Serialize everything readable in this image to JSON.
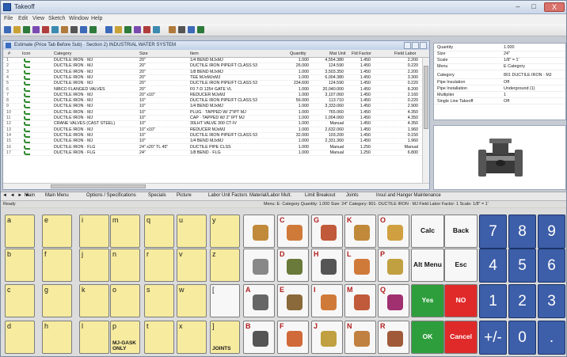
{
  "window": {
    "title": "Takeoff",
    "minimize": "–",
    "maximize": "□",
    "close": "X"
  },
  "menu": [
    "File",
    "Edit",
    "View",
    "Sketch",
    "Window",
    "Help"
  ],
  "toolbar_icons": [
    "new-icon",
    "open-icon",
    "save-icon",
    "print-icon",
    "cut-icon",
    "copy-icon",
    "paste-icon",
    "undo-icon",
    "find-icon",
    "grid-icon",
    "sketch-icon",
    "zoom-icon",
    "pipe-icon",
    "fitting-icon",
    "valve-icon",
    "settings-icon",
    "report-icon",
    "chart-icon",
    "calc-icon",
    "help-icon"
  ],
  "estimate": {
    "title": "Estimate (Price Tab Before Sub) · Section 2) INDUSTRIAL WATER SYSTEM",
    "columns": {
      "num": "#",
      "icon": "Icon",
      "category": "Category",
      "size": "Size",
      "item": "Item",
      "quantity": "Quantity",
      "mat": "Mat Unit",
      "fld": "Fld Factor",
      "labor": "Field Labor"
    },
    "rows": [
      {
        "n": "1",
        "cat": "DUCTILE IRON · MJ",
        "size": "20\"",
        "item": "1/4 BEND MJxMJ",
        "qty": "1.000",
        "mat": "4,554.380",
        "fld": "1.450",
        "lab": "2.200"
      },
      {
        "n": "2",
        "cat": "DUCTILE IRON · MJ",
        "size": "20\"",
        "item": "DUCTILE IRON PIPE/FT CLASS 53",
        "qty": "26.000",
        "mat": "124.590",
        "fld": "1.450",
        "lab": "0.220"
      },
      {
        "n": "3",
        "cat": "DUCTILE IRON · MJ",
        "size": "20\"",
        "item": "1/8 BEND MJxMJ",
        "qty": "1.000",
        "mat": "3,503.350",
        "fld": "1.450",
        "lab": "2.200"
      },
      {
        "n": "4",
        "cat": "DUCTILE IRON · MJ",
        "size": "20\"",
        "item": "TEE MJxMJxMJ",
        "qty": "1.000",
        "mat": "6,004.380",
        "fld": "1.450",
        "lab": "3.300"
      },
      {
        "n": "5",
        "cat": "DUCTILE IRON · MJ",
        "size": "20\"",
        "item": "DUCTILE IRON PIPE/FT CLASS 53",
        "qty": "234.600",
        "mat": "124.590",
        "fld": "1.450",
        "lab": "0.220"
      },
      {
        "n": "6",
        "cat": "NIBCO FLANGED VALVES",
        "size": "20\"",
        "item": "F0 7-D 125# GATE VL",
        "qty": "1.000",
        "mat": "20,040.000",
        "fld": "1.450",
        "lab": "8.200"
      },
      {
        "n": "7",
        "cat": "DUCTILE IRON · MJ",
        "size": "20\" x10\"",
        "item": "REDUCER MJxMJ",
        "qty": "1.000",
        "mat": "3,107.060",
        "fld": "1.450",
        "lab": "2.160"
      },
      {
        "n": "8",
        "cat": "DUCTILE IRON · MJ",
        "size": "10\"",
        "item": "DUCTILE IRON PIPE/FT CLASS 53",
        "qty": "56.000",
        "mat": "113.710",
        "fld": "1.450",
        "lab": "0.220"
      },
      {
        "n": "9",
        "cat": "DUCTILE IRON · MJ",
        "size": "10\"",
        "item": "1/4 BEND MJxMJ",
        "qty": "1.000",
        "mat": "3,333.060",
        "fld": "1.450",
        "lab": "2.900"
      },
      {
        "n": "10",
        "cat": "DUCTILE IRON · MJ",
        "size": "10\"",
        "item": "PLUG · TAPPED W/ 2\"IPT MJ",
        "qty": "1.000",
        "mat": "765.060",
        "fld": "1.450",
        "lab": "4.350"
      },
      {
        "n": "11",
        "cat": "DUCTILE IRON · MJ",
        "size": "10\"",
        "item": "CAP · TAPPED W/ 2\" IPT MJ",
        "qty": "1.000",
        "mat": "1,004.060",
        "fld": "1.450",
        "lab": "4.350"
      },
      {
        "n": "12",
        "cat": "CRANE VALVES (CAST STEEL)",
        "size": "10\"",
        "item": "30LHT VALVE 300 CT-IV",
        "qty": "1.000",
        "mat": "Manual",
        "fld": "1.450",
        "lab": "4.350"
      },
      {
        "n": "13",
        "cat": "DUCTILE IRON · MJ",
        "size": "10\" x10\"",
        "item": "REDUCER MJxMJ",
        "qty": "1.000",
        "mat": "2,632.060",
        "fld": "1.450",
        "lab": "1.960"
      },
      {
        "n": "14",
        "cat": "DUCTILE IRON · MJ",
        "size": "10\"",
        "item": "DUCTILE IRON PIPE/FT CLASS 53",
        "qty": "32.000",
        "mat": "103.200",
        "fld": "1.450",
        "lab": "0.150"
      },
      {
        "n": "15",
        "cat": "DUCTILE IRON · MJ",
        "size": "10\"",
        "item": "1/4 BEND MJxMJ",
        "qty": "1.000",
        "mat": "2,331.360",
        "fld": "1.450",
        "lab": "1.960"
      },
      {
        "n": "16",
        "cat": "DUCTILE IRON · FLG",
        "size": "24\" x20\" TL 45\"",
        "item": "DUCTILE PIPE CLSS",
        "qty": "1.000",
        "mat": "Manual",
        "fld": "1.250",
        "lab": "Manual"
      },
      {
        "n": "17",
        "cat": "DUCTILE IRON · FLG",
        "size": "24\"",
        "item": "1/8 BEND · FLG",
        "qty": "1.000",
        "mat": "Manual",
        "fld": "1.250",
        "lab": "6.800"
      }
    ]
  },
  "properties": [
    {
      "label": "Quantity",
      "value": "1.000"
    },
    {
      "label": "Size",
      "value": "24\""
    },
    {
      "label": "Scale",
      "value": "1/8\" = 1'"
    },
    {
      "label": "Menu",
      "value": "E Category"
    },
    {
      "label": "Category",
      "value": "801 DUCTILE IRON · MJ"
    },
    {
      "label": "Pipe Insulation",
      "value": "Off"
    },
    {
      "label": "Pipe Installation",
      "value": "Underground (1)"
    },
    {
      "label": "Multiplier",
      "value": "1"
    },
    {
      "label": "Single Line Takeoff",
      "value": "Off"
    }
  ],
  "sheet_tabs": {
    "nav": "◄ ◄ ► ►",
    "tabs": [
      "Main",
      "Main Menu",
      "Options / Specifications",
      "Specials",
      "Picture",
      "Labor Unit Factors",
      "Material/Labor Mult.",
      "Limit Breakout",
      "Joints",
      "Insul and Hanger Maintenance"
    ]
  },
  "status": {
    "ready": "Ready",
    "info": "Menu: E· Category   Quantity: 1.000   Size: 24\"   Category: 801· DUCTILE IRON · MJ   Field Labor Factor: 1   Scale: 1/8\" = 1'"
  },
  "keypad": {
    "letter_keys": [
      {
        "l": "a",
        "cap": "",
        "color": "yellow"
      },
      {
        "l": "e",
        "cap": "",
        "color": "yellow"
      },
      {
        "l": "i",
        "cap": "",
        "color": "yellow"
      },
      {
        "l": "m",
        "cap": "",
        "color": "yellow"
      },
      {
        "l": "q",
        "cap": "",
        "color": "yellow"
      },
      {
        "l": "u",
        "cap": "",
        "color": "yellow"
      },
      {
        "l": "y",
        "cap": "",
        "color": "yellow"
      },
      {
        "l": "b",
        "cap": "",
        "color": "yellow"
      },
      {
        "l": "f",
        "cap": "",
        "color": "yellow"
      },
      {
        "l": "j",
        "cap": "",
        "color": "yellow"
      },
      {
        "l": "n",
        "cap": "",
        "color": "yellow"
      },
      {
        "l": "r",
        "cap": "",
        "color": "yellow"
      },
      {
        "l": "v",
        "cap": "",
        "color": "yellow"
      },
      {
        "l": "z",
        "cap": "",
        "color": "yellow"
      },
      {
        "l": "c",
        "cap": "",
        "color": "yellow"
      },
      {
        "l": "g",
        "cap": "",
        "color": "yellow"
      },
      {
        "l": "k",
        "cap": "",
        "color": "yellow"
      },
      {
        "l": "o",
        "cap": "",
        "color": "yellow"
      },
      {
        "l": "s",
        "cap": "",
        "color": "yellow"
      },
      {
        "l": "w",
        "cap": "",
        "color": "yellow"
      },
      {
        "l": "[",
        "cap": "",
        "color": "white"
      },
      {
        "l": "d",
        "cap": "",
        "color": "yellow"
      },
      {
        "l": "h",
        "cap": "",
        "color": "yellow"
      },
      {
        "l": "l",
        "cap": "",
        "color": "yellow"
      },
      {
        "l": "p",
        "cap": "MJ-GASK ONLY",
        "color": "yellow"
      },
      {
        "l": "t",
        "cap": "",
        "color": "yellow"
      },
      {
        "l": "x",
        "cap": "",
        "color": "yellow"
      },
      {
        "l": "]",
        "cap": "JOINTS",
        "color": "yellow"
      }
    ],
    "picture_keys": [
      {
        "l": "",
        "icon": "valve-wrench-icon"
      },
      {
        "l": "C",
        "icon": "copper-coil-icon"
      },
      {
        "l": "G",
        "icon": "copper-elbow-icon"
      },
      {
        "l": "K",
        "icon": "copper-tee-icon"
      },
      {
        "l": "O",
        "icon": "brass-coupling-icon"
      },
      {
        "l": "",
        "icon": "pipe-bracket-icon"
      },
      {
        "l": "D",
        "icon": "check-valve-icon"
      },
      {
        "l": "H",
        "icon": "globe-valve-icon"
      },
      {
        "l": "L",
        "icon": "copper-reducer-icon"
      },
      {
        "l": "P",
        "icon": "brass-tee-icon"
      },
      {
        "l": "A",
        "icon": "gate-valve-icon"
      },
      {
        "l": "E",
        "icon": "ball-valve-icon"
      },
      {
        "l": "I",
        "icon": "copper-cap-icon"
      },
      {
        "l": "M",
        "icon": "copper-fitting-icon"
      },
      {
        "l": "Q",
        "icon": "p-trap-icon"
      },
      {
        "l": "B",
        "icon": "butterfly-valve-icon"
      },
      {
        "l": "F",
        "icon": "copper-bend-icon"
      },
      {
        "l": "J",
        "icon": "brass-union-icon"
      },
      {
        "l": "N",
        "icon": "copper-adapter-icon"
      },
      {
        "l": "R",
        "icon": "bronze-valve-icon"
      }
    ],
    "function_keys": {
      "calc": "Calc",
      "back": "Back",
      "alt_menu": "Alt Menu",
      "esc": "Esc",
      "yes": "Yes",
      "no": "NO",
      "ok": "OK",
      "cancel": "Cancel"
    },
    "number_keys": [
      "7",
      "8",
      "9",
      "4",
      "5",
      "6",
      "1",
      "2",
      "3",
      "+/-",
      "0",
      "."
    ],
    "colors": {
      "yes": "#2e9e3c",
      "no": "#e02a2a",
      "ok": "#2e9e3c",
      "cancel": "#e02a2a",
      "numpad": "#3d5ea8",
      "letter": "#f7eb9f"
    }
  }
}
